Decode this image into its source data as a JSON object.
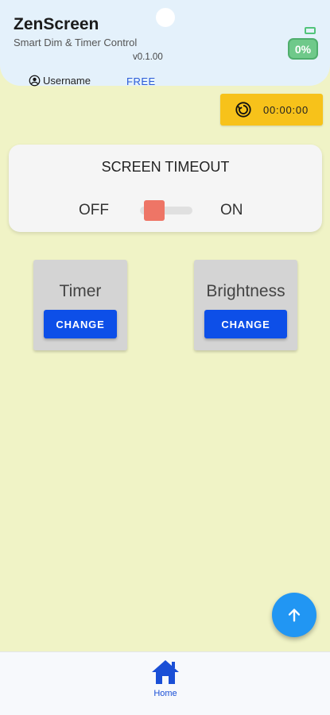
{
  "app": {
    "title": "ZenScreen",
    "subtitle": "Smart Dim & Timer Control",
    "version": "v0.1.00"
  },
  "user": {
    "name": "Username",
    "plan": "FREE"
  },
  "battery": {
    "level": "0%"
  },
  "timer": {
    "display": "00:00:00"
  },
  "screen_timeout": {
    "title": "SCREEN TIMEOUT",
    "off_label": "OFF",
    "on_label": "ON",
    "state": "OFF"
  },
  "features": {
    "timer": {
      "label": "Timer",
      "button": "CHANGE"
    },
    "brightness": {
      "label": "Brightness",
      "button": "CHANGE"
    }
  },
  "nav": {
    "home_label": "Home"
  },
  "colors": {
    "background": "#f0f3c6",
    "header": "#e4f1fb",
    "accent": "#0d4fe8",
    "timer_pill": "#f7c21a",
    "battery": "#6fc98a",
    "switch_thumb": "#ee7566",
    "fab": "#2196f3"
  },
  "icons": {
    "user": "account-circle-icon",
    "timer": "timer-reset-icon",
    "fab": "arrow-up-icon",
    "home": "home-icon",
    "battery": "battery-icon"
  }
}
